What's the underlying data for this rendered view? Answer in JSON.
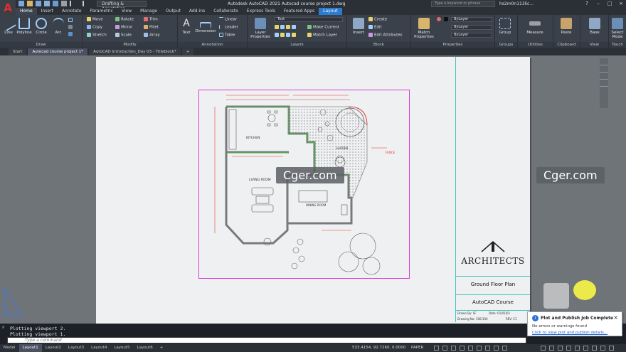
{
  "app": {
    "logo": "A",
    "title": "Autodesk AutoCAD 2021   Autocad course project 1.dwg",
    "workspace": "Drafting & Annotation",
    "search_placeholder": "Type a keyword or phrase",
    "user": "hs2m0n113lic..."
  },
  "ribbon_tabs": [
    "Home",
    "Insert",
    "Annotate",
    "Parametric",
    "View",
    "Manage",
    "Output",
    "Add-ins",
    "Collaborate",
    "Express Tools",
    "Featured Apps",
    "Layout"
  ],
  "ribbon": {
    "draw": {
      "label": "Draw",
      "line": "Line",
      "polyline": "Polyline",
      "circle": "Circle",
      "arc": "Arc"
    },
    "modify": {
      "label": "Modify",
      "move": "Move",
      "rotate": "Rotate",
      "trim": "Trim",
      "copy": "Copy",
      "mirror": "Mirror",
      "fillet": "Fillet",
      "stretch": "Stretch",
      "scale": "Scale",
      "array": "Array"
    },
    "annotation": {
      "label": "Annotation",
      "text": "Text",
      "dimension": "Dimension",
      "linear": "Linear",
      "leader": "Leader",
      "table": "Table"
    },
    "layers": {
      "label": "Layers",
      "layer_properties": "Layer Properties",
      "current_layer": "Text",
      "make_current": "Make Current",
      "match_layer": "Match Layer"
    },
    "block": {
      "label": "Block",
      "insert": "Insert",
      "create": "Create",
      "edit": "Edit",
      "edit_attributes": "Edit Attributes"
    },
    "properties": {
      "label": "Properties",
      "match": "Match Properties",
      "color": "ByLayer",
      "linetype": "ByLayer",
      "lineweight": "ByLayer"
    },
    "groups": {
      "label": "Groups",
      "group": "Group"
    },
    "utilities": {
      "label": "Utilities",
      "measure": "Measure"
    },
    "clipboard": {
      "label": "Clipboard",
      "paste": "Paste"
    },
    "view": {
      "label": "View",
      "base": "Base"
    },
    "touch": {
      "label": "Touch",
      "select_mode": "Select Mode"
    }
  },
  "doc_tabs": [
    "Start",
    "Autocad course project 1*",
    "AutoCAD Introduction_Day 03 - Titleblock*"
  ],
  "drawing": {
    "rooms": [
      "KITCHEN",
      "GARDEN",
      "LIVING ROOM",
      "DINING ROOM"
    ],
    "fence_label": "FENCE",
    "watermark": "Cger.com"
  },
  "titleblock": {
    "company": "ARCHITECTS",
    "sheet_title": "Ground Floor Plan",
    "course": "AutoCAD Course",
    "drawn_by": "Drawn By: SF",
    "date": "Date: 01/01/01",
    "drawing_no": "Drawing No: 100/100",
    "rev": "REV: C1"
  },
  "command": {
    "lines": [
      "Plotting viewport 2.",
      "Plotting viewport 1."
    ],
    "placeholder": "Type a command"
  },
  "layout_tabs": [
    "Model",
    "Layout1",
    "Layout2",
    "Layout3",
    "Layout4",
    "Layout5",
    "Layout6"
  ],
  "status": {
    "coords": "533.4154, 92.7260, 0.0000",
    "space": "PAPER"
  },
  "notification": {
    "title": "Plot and Publish Job Complete",
    "message": "No errors or warnings found",
    "link": "Click to view plot and publish details..."
  },
  "colors": {
    "accent": "#2b7bd1",
    "viewport_border": "#d63fd6",
    "titleblock_lines": "#46c2c2"
  }
}
